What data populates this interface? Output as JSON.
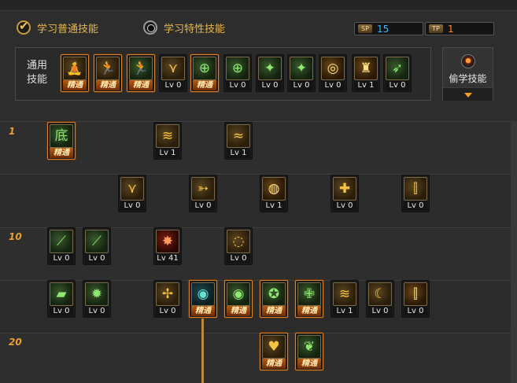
{
  "options": {
    "learn_common": "学习普通技能",
    "learn_special": "学习特性技能"
  },
  "points": {
    "sp_icon": "SP",
    "sp_value": "15",
    "tp_icon": "TP",
    "tp_value": "1"
  },
  "general": {
    "label": "通用\n技能",
    "skills": [
      {
        "icon": "rest-figure-icon",
        "glyph": "🧘",
        "color": "gold",
        "badge": "精通",
        "mastered": true
      },
      {
        "icon": "rising-figure-icon",
        "glyph": "🏃",
        "color": "gold",
        "badge": "精通",
        "mastered": true
      },
      {
        "icon": "sprint-figure-icon",
        "glyph": "🏃",
        "color": "green",
        "badge": "精通",
        "mastered": true
      },
      {
        "icon": "eagle-wings-icon",
        "glyph": "⋎",
        "color": "gold",
        "badge": "Lv 0",
        "mastered": false
      },
      {
        "icon": "crosshair-icon",
        "glyph": "⊕",
        "color": "green",
        "badge": "精通",
        "mastered": true
      },
      {
        "icon": "target-sight-icon",
        "glyph": "⊕",
        "color": "green",
        "badge": "Lv 0",
        "mastered": false
      },
      {
        "icon": "strike-figure-icon",
        "glyph": "✦",
        "color": "green",
        "badge": "Lv 0",
        "mastered": false
      },
      {
        "icon": "strike-figure-2-icon",
        "glyph": "✦",
        "color": "green",
        "badge": "Lv 0",
        "mastered": false
      },
      {
        "icon": "vortex-icon",
        "glyph": "◎",
        "color": "amber",
        "badge": "Lv 0",
        "mastered": false
      },
      {
        "icon": "power-figure-icon",
        "glyph": "♜",
        "color": "amber",
        "badge": "Lv 1",
        "mastered": false
      },
      {
        "icon": "dash-figure-icon",
        "glyph": "➶",
        "color": "green",
        "badge": "Lv 0",
        "mastered": false
      }
    ]
  },
  "steal": {
    "label": "偷学技能",
    "icon": "steal-orb-icon"
  },
  "tree": {
    "levels": [
      "1",
      "10",
      "20"
    ],
    "skills": [
      {
        "icon": "bottom-blade-icon",
        "glyph": "底",
        "color": "green",
        "badge": "精通",
        "mastered": true
      },
      {
        "icon": "claw-slash-icon",
        "glyph": "≋",
        "color": "gold",
        "badge": "Lv 1",
        "mastered": false
      },
      {
        "icon": "wave-slash-icon",
        "glyph": "≈",
        "color": "gold",
        "badge": "Lv 1",
        "mastered": false
      },
      {
        "icon": "wing-burst-icon",
        "glyph": "⋎",
        "color": "gold",
        "badge": "Lv 0",
        "mastered": false
      },
      {
        "icon": "arrow-thrust-icon",
        "glyph": "➳",
        "color": "gold",
        "badge": "Lv 0",
        "mastered": false
      },
      {
        "icon": "spiral-slash-icon",
        "glyph": "◍",
        "color": "amber",
        "badge": "Lv 1",
        "mastered": false
      },
      {
        "icon": "shield-cross-icon",
        "glyph": "✚",
        "color": "gold",
        "badge": "Lv 0",
        "mastered": false
      },
      {
        "icon": "triple-blade-icon",
        "glyph": "⫿",
        "color": "gold",
        "badge": "Lv 0",
        "mastered": false
      },
      {
        "icon": "green-sword-icon",
        "glyph": "⟋",
        "color": "green",
        "badge": "Lv 0",
        "mastered": false
      },
      {
        "icon": "green-blade-icon",
        "glyph": "⟋",
        "color": "green",
        "badge": "Lv 0",
        "mastered": false
      },
      {
        "icon": "fire-slash-icon",
        "glyph": "✸",
        "color": "red",
        "badge": "Lv 41",
        "mastered": false
      },
      {
        "icon": "gold-vortex-icon",
        "glyph": "◌",
        "color": "gold",
        "badge": "Lv 0",
        "mastered": false
      },
      {
        "icon": "green-bar-icon",
        "glyph": "▰",
        "color": "green",
        "badge": "Lv 0",
        "mastered": false
      },
      {
        "icon": "green-burst-icon",
        "glyph": "✹",
        "color": "green",
        "badge": "Lv 0",
        "mastered": false
      },
      {
        "icon": "gold-cross-sword-icon",
        "glyph": "✢",
        "color": "gold",
        "badge": "Lv 0",
        "mastered": false
      },
      {
        "icon": "teal-eye-icon",
        "glyph": "◉",
        "color": "teal",
        "badge": "精通",
        "mastered": true
      },
      {
        "icon": "green-eye-icon",
        "glyph": "◉",
        "color": "green",
        "badge": "精通",
        "mastered": true
      },
      {
        "icon": "muscle-figure-icon",
        "glyph": "✪",
        "color": "green",
        "badge": "精通",
        "mastered": true
      },
      {
        "icon": "holy-cross-icon",
        "glyph": "✙",
        "color": "green",
        "badge": "精通",
        "mastered": true
      },
      {
        "icon": "gold-wave-icon",
        "glyph": "≋",
        "color": "gold",
        "badge": "Lv 1",
        "mastered": false
      },
      {
        "icon": "crescent-icon",
        "glyph": "☾",
        "color": "gold",
        "badge": "Lv 0",
        "mastered": false
      },
      {
        "icon": "flame-blade-icon",
        "glyph": "⫿",
        "color": "amber",
        "badge": "Lv 0",
        "mastered": false
      },
      {
        "icon": "heart-shield-icon",
        "glyph": "♥",
        "color": "gold",
        "badge": "精通",
        "mastered": true
      },
      {
        "icon": "green-dragon-icon",
        "glyph": "❦",
        "color": "green",
        "badge": "精通",
        "mastered": true
      }
    ]
  }
}
